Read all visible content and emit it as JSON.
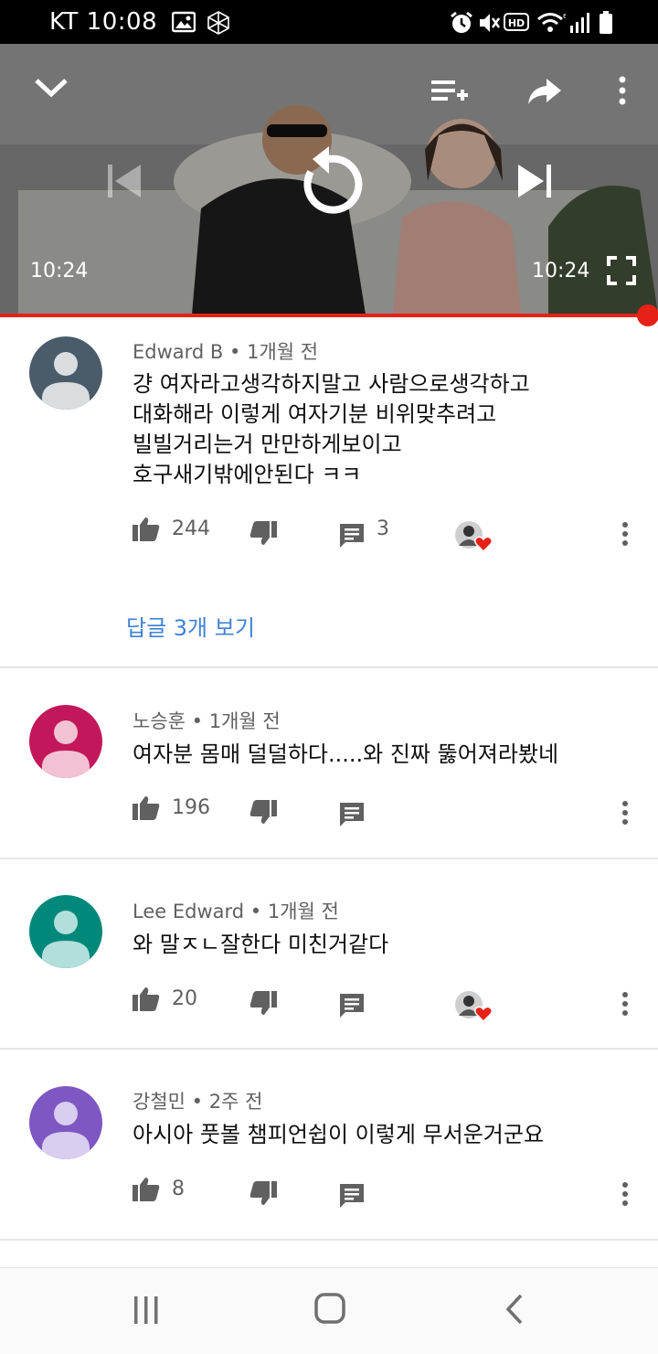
{
  "status_bar": {
    "carrier_time": "KT 10:08"
  },
  "player": {
    "time_current": "10:24",
    "time_total": "10:24",
    "progress_fraction": 1.0
  },
  "comments": [
    {
      "author": "Edward B",
      "time": "1개월 전",
      "text": "걍 여자라고생각하지말고 사람으로생각하고\n대화해라 이렇게 여자기분 비위맞추려고\n빌빌거리는거 만만하게보이고\n호구새기밖에안된다 ㅋㅋ",
      "likes": "244",
      "reply_count": "3",
      "creator_heart": true,
      "avatar_color": "#4a5c6a",
      "view_replies": "답글 3개 보기"
    },
    {
      "author": "노승훈",
      "time": "1개월 전",
      "text": "여자분 몸매 덜덜하다.....와 진짜 뚫어져라봤네",
      "likes": "196",
      "reply_count": "",
      "creator_heart": false,
      "avatar_color": "#c2185b"
    },
    {
      "author": "Lee Edward",
      "time": "1개월 전",
      "text": "와 말ㅈㄴ잘한다 미친거같다",
      "likes": "20",
      "reply_count": "",
      "creator_heart": true,
      "avatar_color": "#00897b"
    },
    {
      "author": "강철민",
      "time": "2주 전",
      "text": "아시아 풋볼 챔피언쉽이 이렇게 무서운거군요",
      "likes": "8",
      "reply_count": "",
      "creator_heart": false,
      "avatar_color": "#7e57c2"
    }
  ],
  "icons": {
    "status": [
      "gallery-icon",
      "app-icon",
      "alarm-icon",
      "mute-icon",
      "hd-icon",
      "wifi-icon",
      "signal-icon",
      "battery-icon"
    ],
    "player": [
      "collapse-icon",
      "add-to-playlist-icon",
      "share-icon",
      "more-icon",
      "previous-icon",
      "replay-icon",
      "next-icon",
      "fullscreen-icon"
    ],
    "comment": [
      "thumb-up-icon",
      "thumb-down-icon",
      "reply-icon",
      "creator-heart-icon",
      "more-icon"
    ],
    "nav": [
      "recents-icon",
      "home-icon",
      "back-icon"
    ]
  }
}
